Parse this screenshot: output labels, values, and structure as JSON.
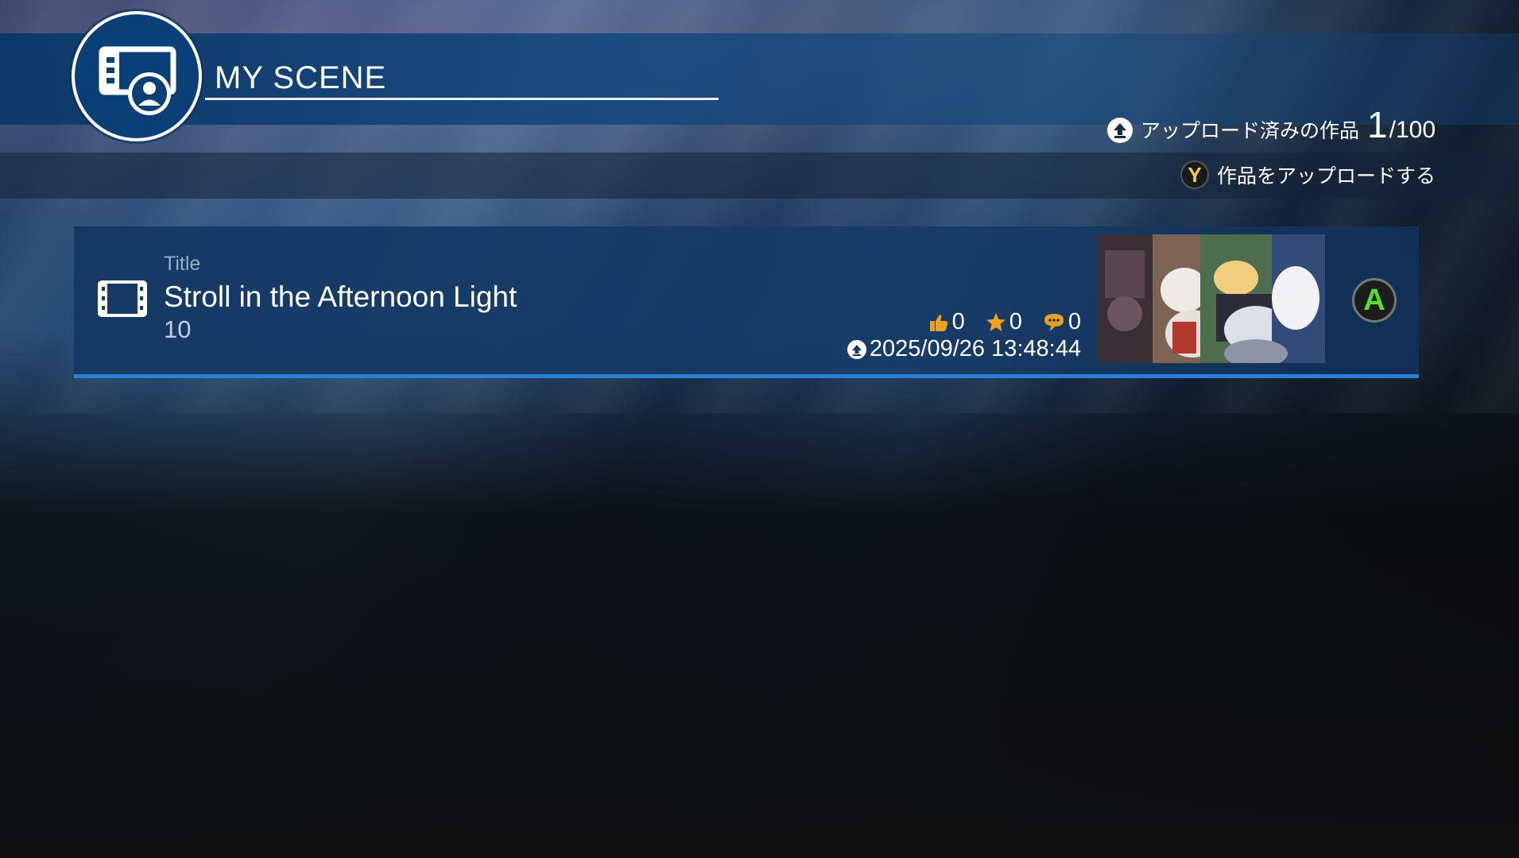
{
  "header": {
    "title": "MY SCENE",
    "upload_label": "アップロード済みの作品",
    "upload_count": "1",
    "upload_max": "/100",
    "upload_action_button": "Y",
    "upload_action_label": "作品をアップロードする"
  },
  "scene": {
    "label": "Title",
    "title": "Stroll in the Afternoon Light",
    "sub_value": "10",
    "likes": "0",
    "favorites": "0",
    "comments": "0",
    "upload_date": "2025/09/26 13:48:44",
    "confirm_button": "A"
  },
  "colors": {
    "accent_blue": "#2a7fd6",
    "header_blue": "#0b3f78",
    "icon_orange": "#f0a020",
    "y_button": "#f1d33a",
    "a_button": "#57dd2e"
  }
}
